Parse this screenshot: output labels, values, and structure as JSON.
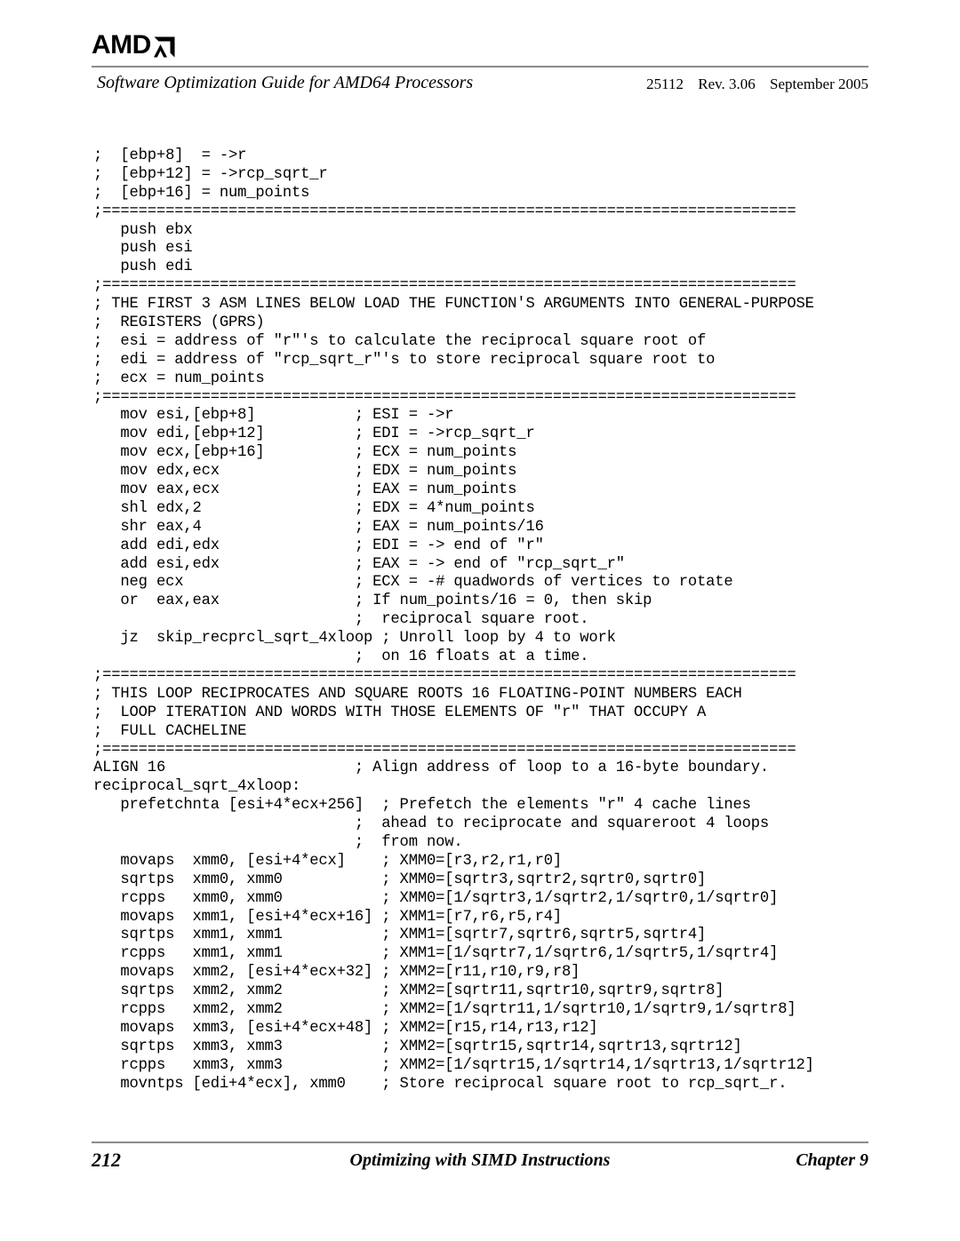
{
  "header": {
    "logo_text": "AMD",
    "logo_icon": "amd-arrow-icon",
    "doc_title": "Software Optimization Guide for AMD64 Processors",
    "doc_number": "25112",
    "revision": "Rev. 3.06",
    "date": "September 2005"
  },
  "code": {
    "language": "x86-assembly",
    "lines": [
      ";  [ebp+8]  = ->r",
      ";  [ebp+12] = ->rcp_sqrt_r",
      ";  [ebp+16] = num_points",
      ";=============================================================================",
      "   push ebx",
      "   push esi",
      "   push edi",
      ";=============================================================================",
      "; THE FIRST 3 ASM LINES BELOW LOAD THE FUNCTION'S ARGUMENTS INTO GENERAL-PURPOSE",
      ";  REGISTERS (GPRS)",
      ";  esi = address of \"r\"'s to calculate the reciprocal square root of",
      ";  edi = address of \"rcp_sqrt_r\"'s to store reciprocal square root to",
      ";  ecx = num_points",
      ";=============================================================================",
      "   mov esi,[ebp+8]           ; ESI = ->r",
      "   mov edi,[ebp+12]          ; EDI = ->rcp_sqrt_r",
      "   mov ecx,[ebp+16]          ; ECX = num_points",
      "   mov edx,ecx               ; EDX = num_points",
      "   mov eax,ecx               ; EAX = num_points",
      "   shl edx,2                 ; EDX = 4*num_points",
      "   shr eax,4                 ; EAX = num_points/16",
      "   add edi,edx               ; EDI = -> end of \"r\"",
      "   add esi,edx               ; EAX = -> end of \"rcp_sqrt_r\"",
      "   neg ecx                   ; ECX = -# quadwords of vertices to rotate",
      "   or  eax,eax               ; If num_points/16 = 0, then skip",
      "                             ;  reciprocal square root.",
      "   jz  skip_recprcl_sqrt_4xloop ; Unroll loop by 4 to work",
      "                             ;  on 16 floats at a time.",
      ";=============================================================================",
      "; THIS LOOP RECIPROCATES AND SQUARE ROOTS 16 FLOATING-POINT NUMBERS EACH",
      ";  LOOP ITERATION AND WORDS WITH THOSE ELEMENTS OF \"r\" THAT OCCUPY A",
      ";  FULL CACHELINE",
      ";=============================================================================",
      "ALIGN 16                     ; Align address of loop to a 16-byte boundary.",
      "reciprocal_sqrt_4xloop:",
      "   prefetchnta [esi+4*ecx+256]  ; Prefetch the elements \"r\" 4 cache lines",
      "                             ;  ahead to reciprocate and squareroot 4 loops",
      "                             ;  from now.",
      "   movaps  xmm0, [esi+4*ecx]    ; XMM0=[r3,r2,r1,r0]",
      "   sqrtps  xmm0, xmm0           ; XMM0=[sqrtr3,sqrtr2,sqrtr0,sqrtr0]",
      "   rcpps   xmm0, xmm0           ; XMM0=[1/sqrtr3,1/sqrtr2,1/sqrtr0,1/sqrtr0]",
      "   movaps  xmm1, [esi+4*ecx+16] ; XMM1=[r7,r6,r5,r4]",
      "   sqrtps  xmm1, xmm1           ; XMM1=[sqrtr7,sqrtr6,sqrtr5,sqrtr4]",
      "   rcpps   xmm1, xmm1           ; XMM1=[1/sqrtr7,1/sqrtr6,1/sqrtr5,1/sqrtr4]",
      "   movaps  xmm2, [esi+4*ecx+32] ; XMM2=[r11,r10,r9,r8]",
      "   sqrtps  xmm2, xmm2           ; XMM2=[sqrtr11,sqrtr10,sqrtr9,sqrtr8]",
      "   rcpps   xmm2, xmm2           ; XMM2=[1/sqrtr11,1/sqrtr10,1/sqrtr9,1/sqrtr8]",
      "   movaps  xmm3, [esi+4*ecx+48] ; XMM2=[r15,r14,r13,r12]",
      "   sqrtps  xmm3, xmm3           ; XMM2=[sqrtr15,sqrtr14,sqrtr13,sqrtr12]",
      "   rcpps   xmm3, xmm3           ; XMM2=[1/sqrtr15,1/sqrtr14,1/sqrtr13,1/sqrtr12]",
      "   movntps [edi+4*ecx], xmm0    ; Store reciprocal square root to rcp_sqrt_r."
    ]
  },
  "footer": {
    "page_number": "212",
    "section_title": "Optimizing with SIMD Instructions",
    "chapter": "Chapter 9"
  }
}
